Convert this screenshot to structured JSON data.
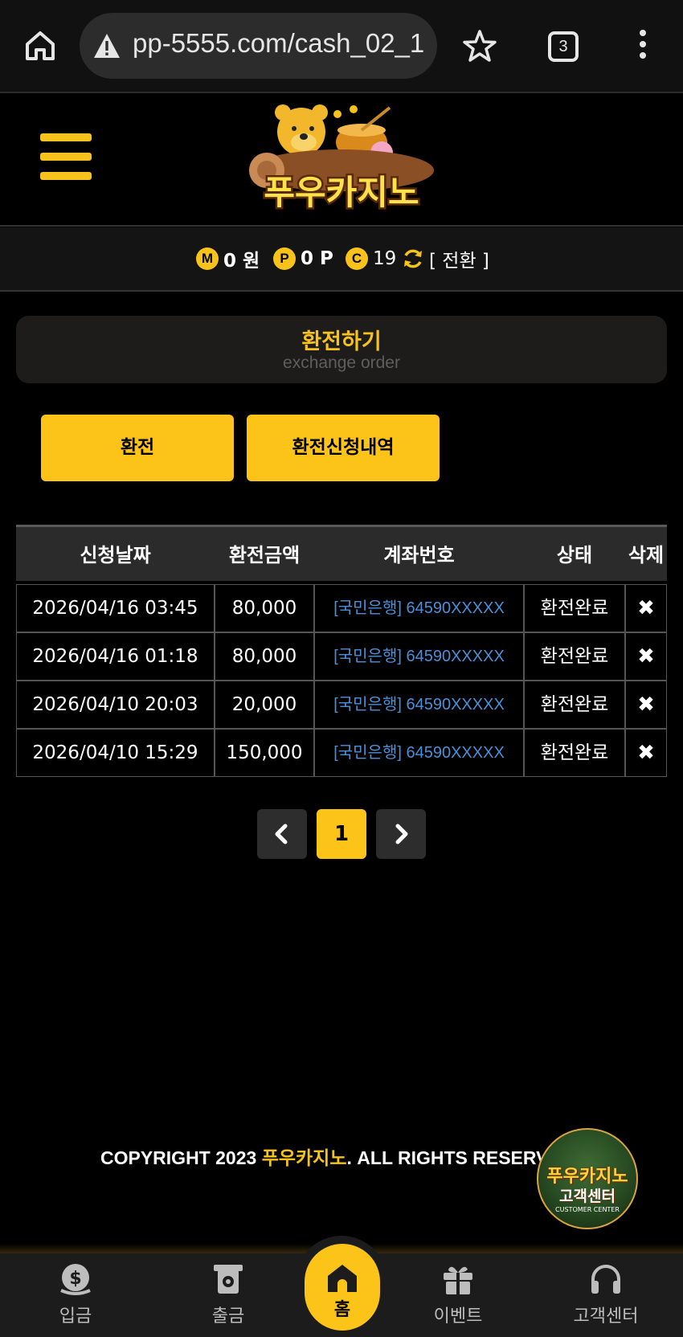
{
  "browser": {
    "url": "pp-5555.com/cash_02_1",
    "tab_count": "3"
  },
  "balance": {
    "money_badge": "M",
    "money": "0 원",
    "point_badge": "P",
    "point": "0 P",
    "coin_badge": "C",
    "coin": "19",
    "convert_label": "[ 전환 ]"
  },
  "page": {
    "title": "환전하기",
    "subtitle": "exchange order"
  },
  "actions": {
    "exchange_label": "환전",
    "history_label": "환전신청내역"
  },
  "table": {
    "headers": [
      "신청날짜",
      "환전금액",
      "계좌번호",
      "상태",
      "삭제"
    ],
    "rows": [
      {
        "date": "2026/04/16 03:45",
        "amount": "80,000",
        "account": "[국민은행] 64590XXXXX",
        "status": "환전완료",
        "delete": "✖"
      },
      {
        "date": "2026/04/16 01:18",
        "amount": "80,000",
        "account": "[국민은행] 64590XXXXX",
        "status": "환전완료",
        "delete": "✖"
      },
      {
        "date": "2026/04/10 20:03",
        "amount": "20,000",
        "account": "[국민은행] 64590XXXXX",
        "status": "환전완료",
        "delete": "✖"
      },
      {
        "date": "2026/04/10 15:29",
        "amount": "150,000",
        "account": "[국민은행] 64590XXXXX",
        "status": "환전완료",
        "delete": "✖"
      }
    ]
  },
  "pagination": {
    "current": "1"
  },
  "footer": {
    "copyright_prefix": "COPYRIGHT 2023 ",
    "brand": "푸우카지노",
    "copyright_suffix": ". ALL RIGHTS RESERVED"
  },
  "logo": {
    "text": "푸우카지노"
  },
  "customer_center_badge": {
    "line1": "푸우카지노",
    "line2": "고객센터",
    "line3": "CUSTOMER CENTER"
  },
  "bottom_nav": {
    "deposit": "입금",
    "withdraw": "출금",
    "home": "홈",
    "event": "이벤트",
    "support": "고객센터"
  },
  "colors": {
    "accent": "#fcc419",
    "account_link": "#4a90d9"
  }
}
